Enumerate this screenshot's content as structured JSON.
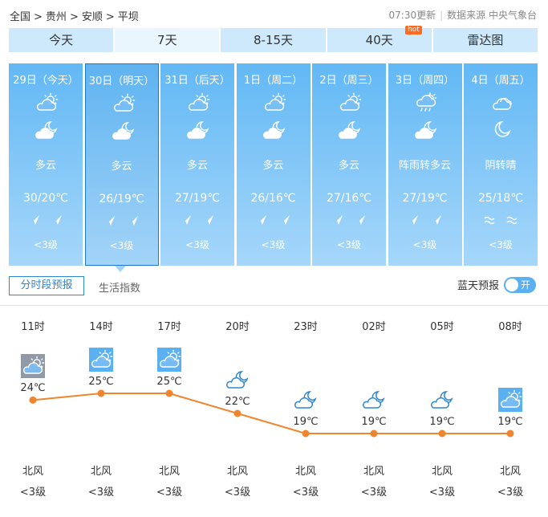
{
  "breadcrumb": {
    "items": [
      "全国",
      "贵州",
      "安顺",
      "平坝"
    ],
    "separator": ">"
  },
  "update": {
    "time": "07:30更新",
    "source": "数据来源 中央气象台"
  },
  "tabs": [
    {
      "label": "今天"
    },
    {
      "label": "7天",
      "active": true
    },
    {
      "label": "8-15天"
    },
    {
      "label": "40天",
      "badge": "hot"
    },
    {
      "label": "雷达图"
    }
  ],
  "days": [
    {
      "date": "29日（今天）",
      "icon_day": "partly-cloudy-day-icon",
      "icon_night": "cloudy-night-icon",
      "desc": "多云",
      "temp": "30/20℃",
      "wind_level": "<3级"
    },
    {
      "date": "30日（明天）",
      "icon_day": "partly-cloudy-day-icon",
      "icon_night": "cloudy-night-icon",
      "desc": "多云",
      "temp": "26/19℃",
      "wind_level": "<3级",
      "selected": true
    },
    {
      "date": "31日（后天）",
      "icon_day": "partly-cloudy-day-icon",
      "icon_night": "cloudy-night-icon",
      "desc": "多云",
      "temp": "27/19℃",
      "wind_level": "<3级"
    },
    {
      "date": "1日（周二）",
      "icon_day": "partly-cloudy-day-icon",
      "icon_night": "cloudy-night-icon",
      "desc": "多云",
      "temp": "26/16℃",
      "wind_level": "<3级"
    },
    {
      "date": "2日（周三）",
      "icon_day": "partly-cloudy-day-icon",
      "icon_night": "cloudy-night-icon",
      "desc": "多云",
      "temp": "27/16℃",
      "wind_level": "<3级"
    },
    {
      "date": "3日（周四）",
      "icon_day": "shower-icon",
      "icon_night": "cloudy-night-icon",
      "desc": "阵雨转多云",
      "temp": "27/19℃",
      "wind_level": "<3级"
    },
    {
      "date": "4日（周五）",
      "icon_day": "cloudy-icon",
      "icon_night": "moon-icon",
      "desc": "阴转晴",
      "temp": "25/18℃",
      "wind_level": "<3级",
      "wind_icon": "wave"
    }
  ],
  "subtabs": {
    "active": "分时段预报",
    "other": "生活指数"
  },
  "blue_sky": {
    "label": "蓝天预报",
    "toggle_label": "开"
  },
  "hourly": {
    "hours": [
      "11时",
      "14时",
      "17时",
      "20时",
      "23时",
      "02时",
      "05时",
      "08时"
    ],
    "temps": [
      24,
      25,
      25,
      22,
      19,
      19,
      19,
      19
    ],
    "temp_labels": [
      "24℃",
      "25℃",
      "25℃",
      "22℃",
      "19℃",
      "19℃",
      "19℃",
      "19℃"
    ],
    "icons": [
      "cloudy-day-grey-icon",
      "partly-cloudy-day-icon",
      "partly-cloudy-day-icon",
      "cloudy-night-icon",
      "cloudy-night-icon",
      "cloudy-night-icon",
      "cloudy-night-icon",
      "partly-cloudy-day-icon"
    ],
    "winds": [
      "北风",
      "北风",
      "北风",
      "北风",
      "北风",
      "北风",
      "北风",
      "北风"
    ],
    "levels": [
      "<3级",
      "<3级",
      "<3级",
      "<3级",
      "<3级",
      "<3级",
      "<3级",
      "<3级"
    ]
  },
  "colors": {
    "line": "#f0852d",
    "accent": "#2e87d3"
  }
}
